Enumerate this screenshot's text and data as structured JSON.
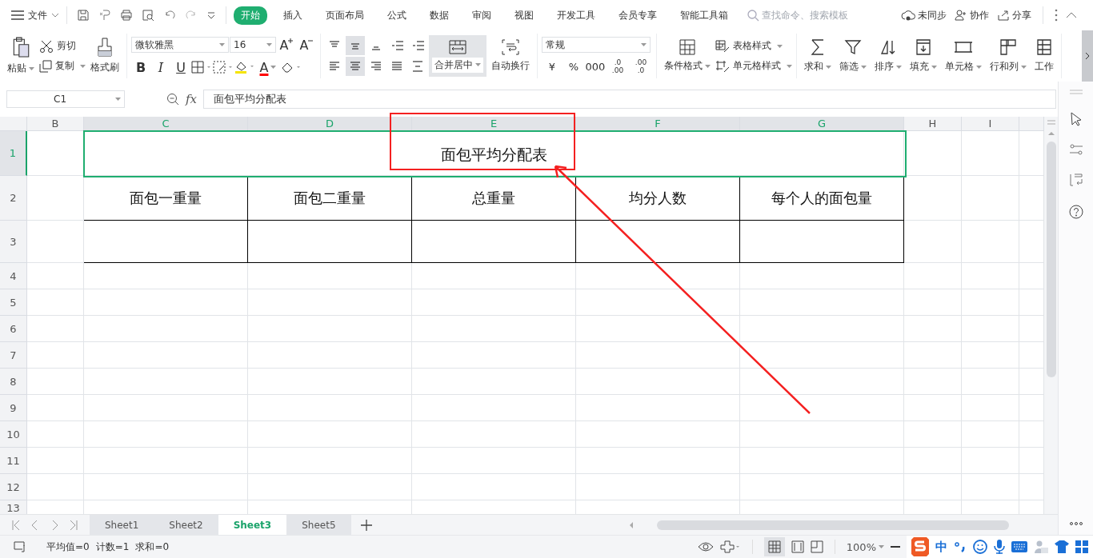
{
  "menu_bar": {
    "file": "文件",
    "tabs": [
      {
        "label": "开始",
        "selected": true
      },
      {
        "label": "插入",
        "selected": false
      },
      {
        "label": "页面布局",
        "selected": false
      },
      {
        "label": "公式",
        "selected": false
      },
      {
        "label": "数据",
        "selected": false
      },
      {
        "label": "审阅",
        "selected": false
      },
      {
        "label": "视图",
        "selected": false
      },
      {
        "label": "开发工具",
        "selected": false
      },
      {
        "label": "会员专享",
        "selected": false
      },
      {
        "label": "智能工具箱",
        "selected": false
      }
    ],
    "search": {
      "placeholder": "查找命令、搜索模板"
    },
    "actions": [
      "未同步",
      "协作",
      "分享"
    ]
  },
  "ribbon": {
    "paste": "粘贴",
    "cut": "剪切",
    "copy": "复制",
    "format_painter": "格式刷",
    "font": "微软雅黑",
    "size": "16",
    "size_buttons": [
      "A",
      "A"
    ],
    "style_buttons": [
      "B",
      "I",
      "U"
    ],
    "font_color": "A",
    "alignment": [
      {
        "selected": false
      },
      {
        "selected": true
      },
      {
        "selected": false
      },
      {
        "selected": false
      },
      {
        "selected": false
      },
      {
        "selected": false
      },
      {
        "selected": true
      },
      {
        "selected": false
      },
      {
        "selected": false
      },
      {
        "selected": false
      }
    ],
    "merge": {
      "label": "合并居中",
      "selected": true
    },
    "wrap": "自动换行",
    "number_format": "常规",
    "number_buttons": [
      "¥",
      "%",
      "000"
    ],
    "decimal_buttons": [
      [
        ".0",
        ".00"
      ],
      [
        ".00",
        ".0"
      ]
    ],
    "cond_format": "条件格式",
    "table_style": "表格样式",
    "cell_style": "单元格样式",
    "tools": [
      "求和",
      "筛选",
      "排序",
      "填充",
      "单元格",
      "行和列",
      "工作"
    ]
  },
  "formula_bar": {
    "name_box": "C1",
    "fx": "fx",
    "value": "面包平均分配表"
  },
  "columns": [
    {
      "label": "B",
      "selected": false
    },
    {
      "label": "C",
      "selected": true
    },
    {
      "label": "D",
      "selected": true
    },
    {
      "label": "E",
      "selected": true
    },
    {
      "label": "F",
      "selected": true
    },
    {
      "label": "G",
      "selected": true
    },
    {
      "label": "H",
      "selected": false
    },
    {
      "label": "I",
      "selected": false
    }
  ],
  "rows": [
    {
      "label": "1",
      "selected": true
    },
    {
      "label": "2",
      "selected": false
    },
    {
      "label": "3",
      "selected": false
    },
    {
      "label": "4",
      "selected": false
    },
    {
      "label": "5",
      "selected": false
    },
    {
      "label": "6",
      "selected": false
    },
    {
      "label": "7",
      "selected": false
    },
    {
      "label": "8",
      "selected": false
    },
    {
      "label": "9",
      "selected": false
    },
    {
      "label": "10",
      "selected": false
    },
    {
      "label": "11",
      "selected": false
    },
    {
      "label": "12",
      "selected": false
    },
    {
      "label": "13",
      "selected": false
    }
  ],
  "table": {
    "title": "面包平均分配表",
    "headers": [
      "面包一重量",
      "面包二重量",
      "总重量",
      "均分人数",
      "每个人的面包量"
    ]
  },
  "sheets": [
    {
      "label": "Sheet1",
      "selected": false
    },
    {
      "label": "Sheet2",
      "selected": false
    },
    {
      "label": "Sheet3",
      "selected": true
    },
    {
      "label": "Sheet5",
      "selected": false
    }
  ],
  "status_bar": {
    "stats": [
      "平均值=0",
      "计数=1",
      "求和=0"
    ],
    "zoom": "100%",
    "ime": "中"
  }
}
